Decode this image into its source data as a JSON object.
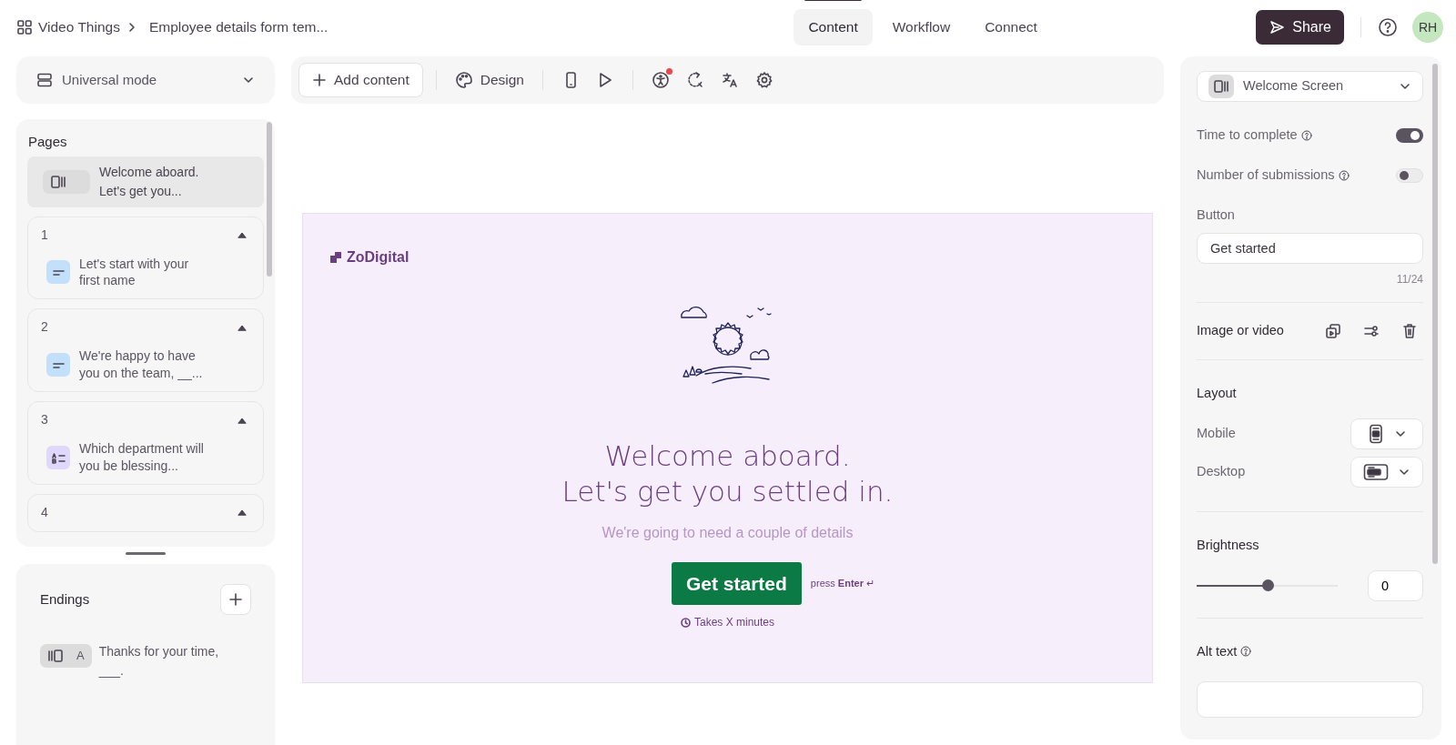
{
  "header": {
    "breadcrumb": [
      "Video Things",
      "Employee details form tem..."
    ],
    "tabs": [
      {
        "label": "Content",
        "selected": true
      },
      {
        "label": "Workflow",
        "selected": false
      },
      {
        "label": "Connect",
        "selected": false
      }
    ],
    "share": "Share",
    "avatar": "RH"
  },
  "mode_select": {
    "value": "Universal mode"
  },
  "toolbar": {
    "add_content": "Add content",
    "design": "Design",
    "accessibility_alert": true
  },
  "pages": {
    "title": "Pages",
    "welcome": {
      "text": "Welcome aboard. Let's get you...",
      "selected": true
    },
    "items": [
      {
        "number": "1",
        "kind": "short-text",
        "text": "Let's start with your first name"
      },
      {
        "number": "2",
        "kind": "short-text",
        "text": "We're happy to have you on the team, __..."
      },
      {
        "number": "3",
        "kind": "multiple-choice",
        "text": "Which department will you be blessing..."
      },
      {
        "number": "4"
      }
    ]
  },
  "endings": {
    "title": "Endings",
    "items": [
      {
        "letter": "A",
        "text": "Thanks for your time, ___."
      }
    ]
  },
  "preview": {
    "logo": "ZoDigital",
    "title": [
      "Welcome aboard.",
      "Let's get you settled in."
    ],
    "subtitle": "We're going to need a couple of details",
    "button": "Get started",
    "hint": "press **Enter** ↵",
    "duration": "Takes X minutes"
  },
  "settings": {
    "screen_select": "Welcome Screen",
    "toggles": [
      {
        "label": "Time to complete",
        "on": true
      },
      {
        "label": "Number of submissions",
        "on": false
      }
    ],
    "button_label": "Button",
    "button_value": "Get started",
    "counter": "11/24",
    "media_label": "Image or video",
    "layout_title": "Layout",
    "layouts": [
      {
        "label": "Mobile",
        "kind": "mobile"
      },
      {
        "label": "Desktop",
        "kind": "desktop"
      }
    ],
    "brightness": {
      "label": "Brightness",
      "level": 0.5,
      "value": "0"
    },
    "alt_text": {
      "label": "Alt text"
    }
  }
}
